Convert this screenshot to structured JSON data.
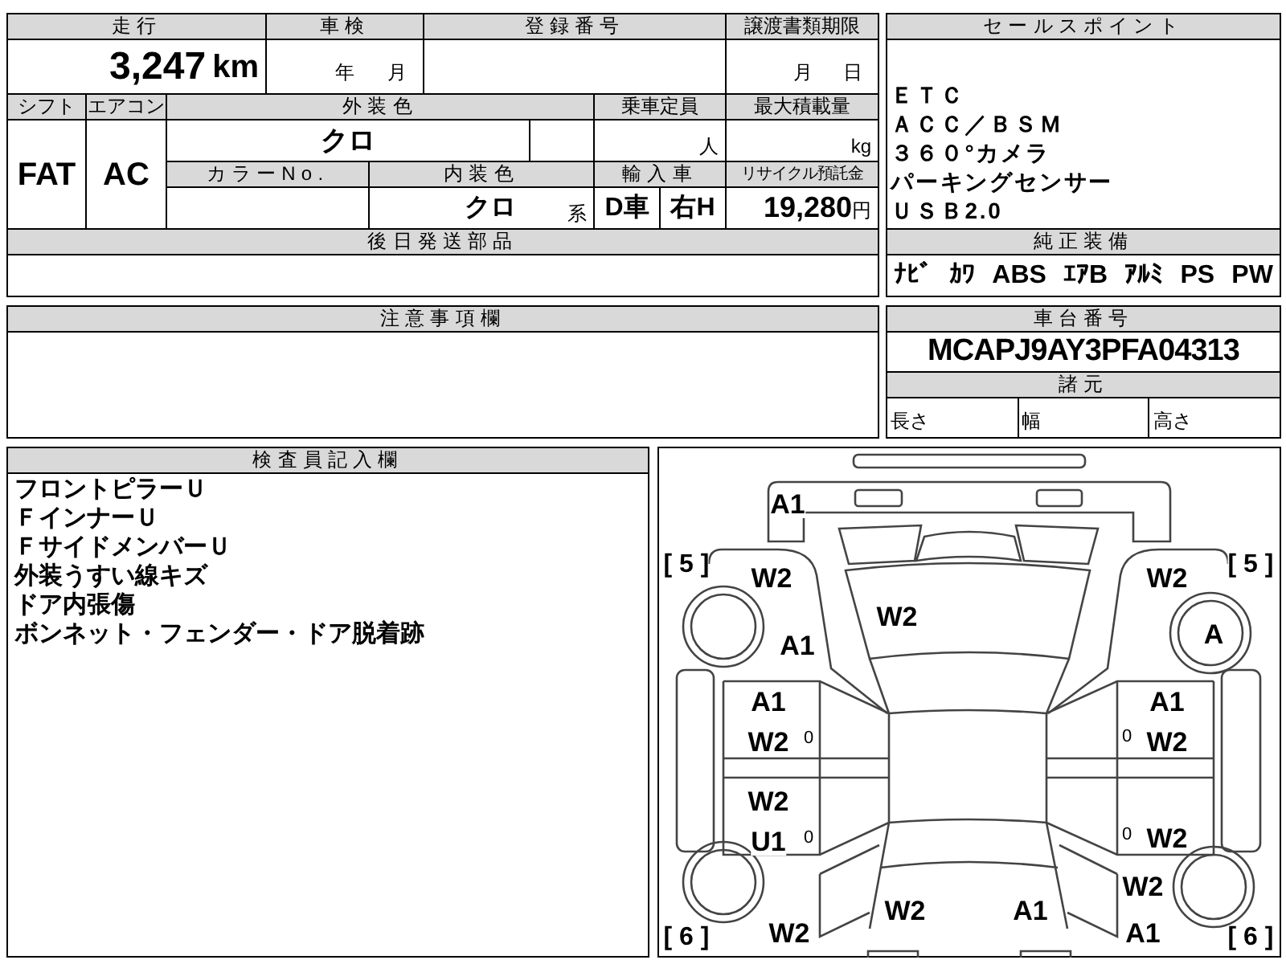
{
  "form": {
    "mileage": {
      "label": "走行",
      "value": "3,247",
      "unit": "km"
    },
    "inspection": {
      "label": "車検",
      "year_unit": "年",
      "month_unit": "月"
    },
    "registration": {
      "label": "登録番号"
    },
    "transfer_deadline": {
      "label": "譲渡書類期限",
      "month_unit": "月",
      "day_unit": "日"
    },
    "shift": {
      "label": "シフト",
      "value": "FAT"
    },
    "aircon": {
      "label": "エアコン",
      "value": "AC"
    },
    "exterior_color": {
      "label": "外装色",
      "value": "クロ"
    },
    "capacity": {
      "label": "乗車定員",
      "unit": "人"
    },
    "max_load": {
      "label": "最大積載量",
      "unit": "kg"
    },
    "color_no": {
      "label": "カラーNo."
    },
    "interior_color": {
      "label": "内装色",
      "value": "クロ",
      "suffix": "系"
    },
    "import": {
      "label": "輸入車",
      "values": [
        "D車",
        "右H"
      ]
    },
    "recycle": {
      "label": "リサイクル預託金",
      "value": "19,280",
      "unit": "円"
    },
    "parts_later": {
      "label": "後日発送部品"
    }
  },
  "sales_points": {
    "label": "セールスポイント",
    "items": [
      "ＥＴＣ",
      "ＡＣＣ／ＢＳＭ",
      "３６０°カメラ",
      "パーキングセンサー",
      "ＵＳＢ2.0"
    ]
  },
  "equipment": {
    "label": "純正装備",
    "items": [
      "ﾅﾋﾞ",
      "ｶﾜ",
      "ABS",
      "ｴｱB",
      "ｱﾙﾐ",
      "PS",
      "PW"
    ]
  },
  "chassis": {
    "label": "車台番号",
    "value": "MCAPJ9AY3PFA04313"
  },
  "specs": {
    "label": "諸元",
    "items": [
      "長さ",
      "幅",
      "高さ"
    ]
  },
  "notes": {
    "label": "注意事項欄"
  },
  "inspector": {
    "label": "検査員記入欄",
    "lines": [
      "フロントピラーＵ",
      "ＦインナーＵ",
      "ＦサイドメンバーＵ",
      "外装うすい線キズ",
      "ドア内張傷",
      "ボンネット・フェンダー・ドア脱着跡"
    ]
  },
  "diagram": {
    "marks": [
      {
        "kind": "code",
        "text": "A1"
      },
      {
        "kind": "bracket",
        "text": "[ 5 ]"
      },
      {
        "kind": "code",
        "text": "W2"
      },
      {
        "kind": "code",
        "text": "W2"
      },
      {
        "kind": "code",
        "text": "A1"
      },
      {
        "kind": "code",
        "text": "W2"
      },
      {
        "kind": "bracket",
        "text": "[ 5 ]"
      },
      {
        "kind": "code",
        "text": "A"
      },
      {
        "kind": "code",
        "text": "A1"
      },
      {
        "kind": "code",
        "text": "W2"
      },
      {
        "kind": "small",
        "text": "0"
      },
      {
        "kind": "code",
        "text": "W2"
      },
      {
        "kind": "code",
        "text": "U1"
      },
      {
        "kind": "small",
        "text": "0"
      },
      {
        "kind": "code",
        "text": "A1"
      },
      {
        "kind": "small",
        "text": "0"
      },
      {
        "kind": "code",
        "text": "W2"
      },
      {
        "kind": "small",
        "text": "0"
      },
      {
        "kind": "code",
        "text": "W2"
      },
      {
        "kind": "code",
        "text": "W2"
      },
      {
        "kind": "code",
        "text": "W2"
      },
      {
        "kind": "code",
        "text": "A1"
      },
      {
        "kind": "bracket",
        "text": "[ 6 ]"
      },
      {
        "kind": "code",
        "text": "W2"
      },
      {
        "kind": "code",
        "text": "A1"
      },
      {
        "kind": "bracket",
        "text": "[ 6 ]"
      }
    ]
  }
}
